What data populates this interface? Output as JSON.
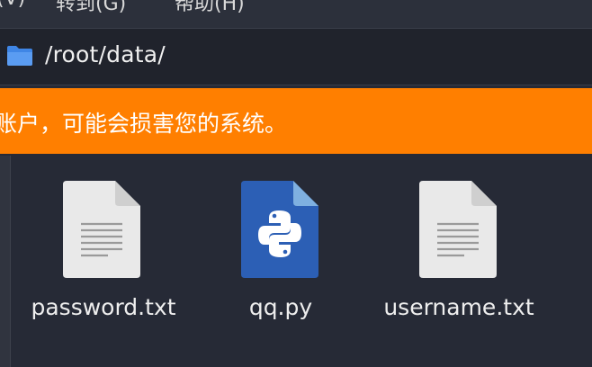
{
  "menubar": {
    "items": [
      {
        "label": "(V)"
      },
      {
        "label": "转到(G)"
      },
      {
        "label": "帮助(H)"
      }
    ]
  },
  "location": {
    "icon": "folder-icon",
    "path": "/root/data/"
  },
  "warning": {
    "text": "账户，可能会损害您的系统。",
    "color": "#ff7f00"
  },
  "files": [
    {
      "name": "password.txt",
      "icon": "text-file-icon"
    },
    {
      "name": "qq.py",
      "icon": "python-file-icon"
    },
    {
      "name": "username.txt",
      "icon": "text-file-icon"
    }
  ]
}
